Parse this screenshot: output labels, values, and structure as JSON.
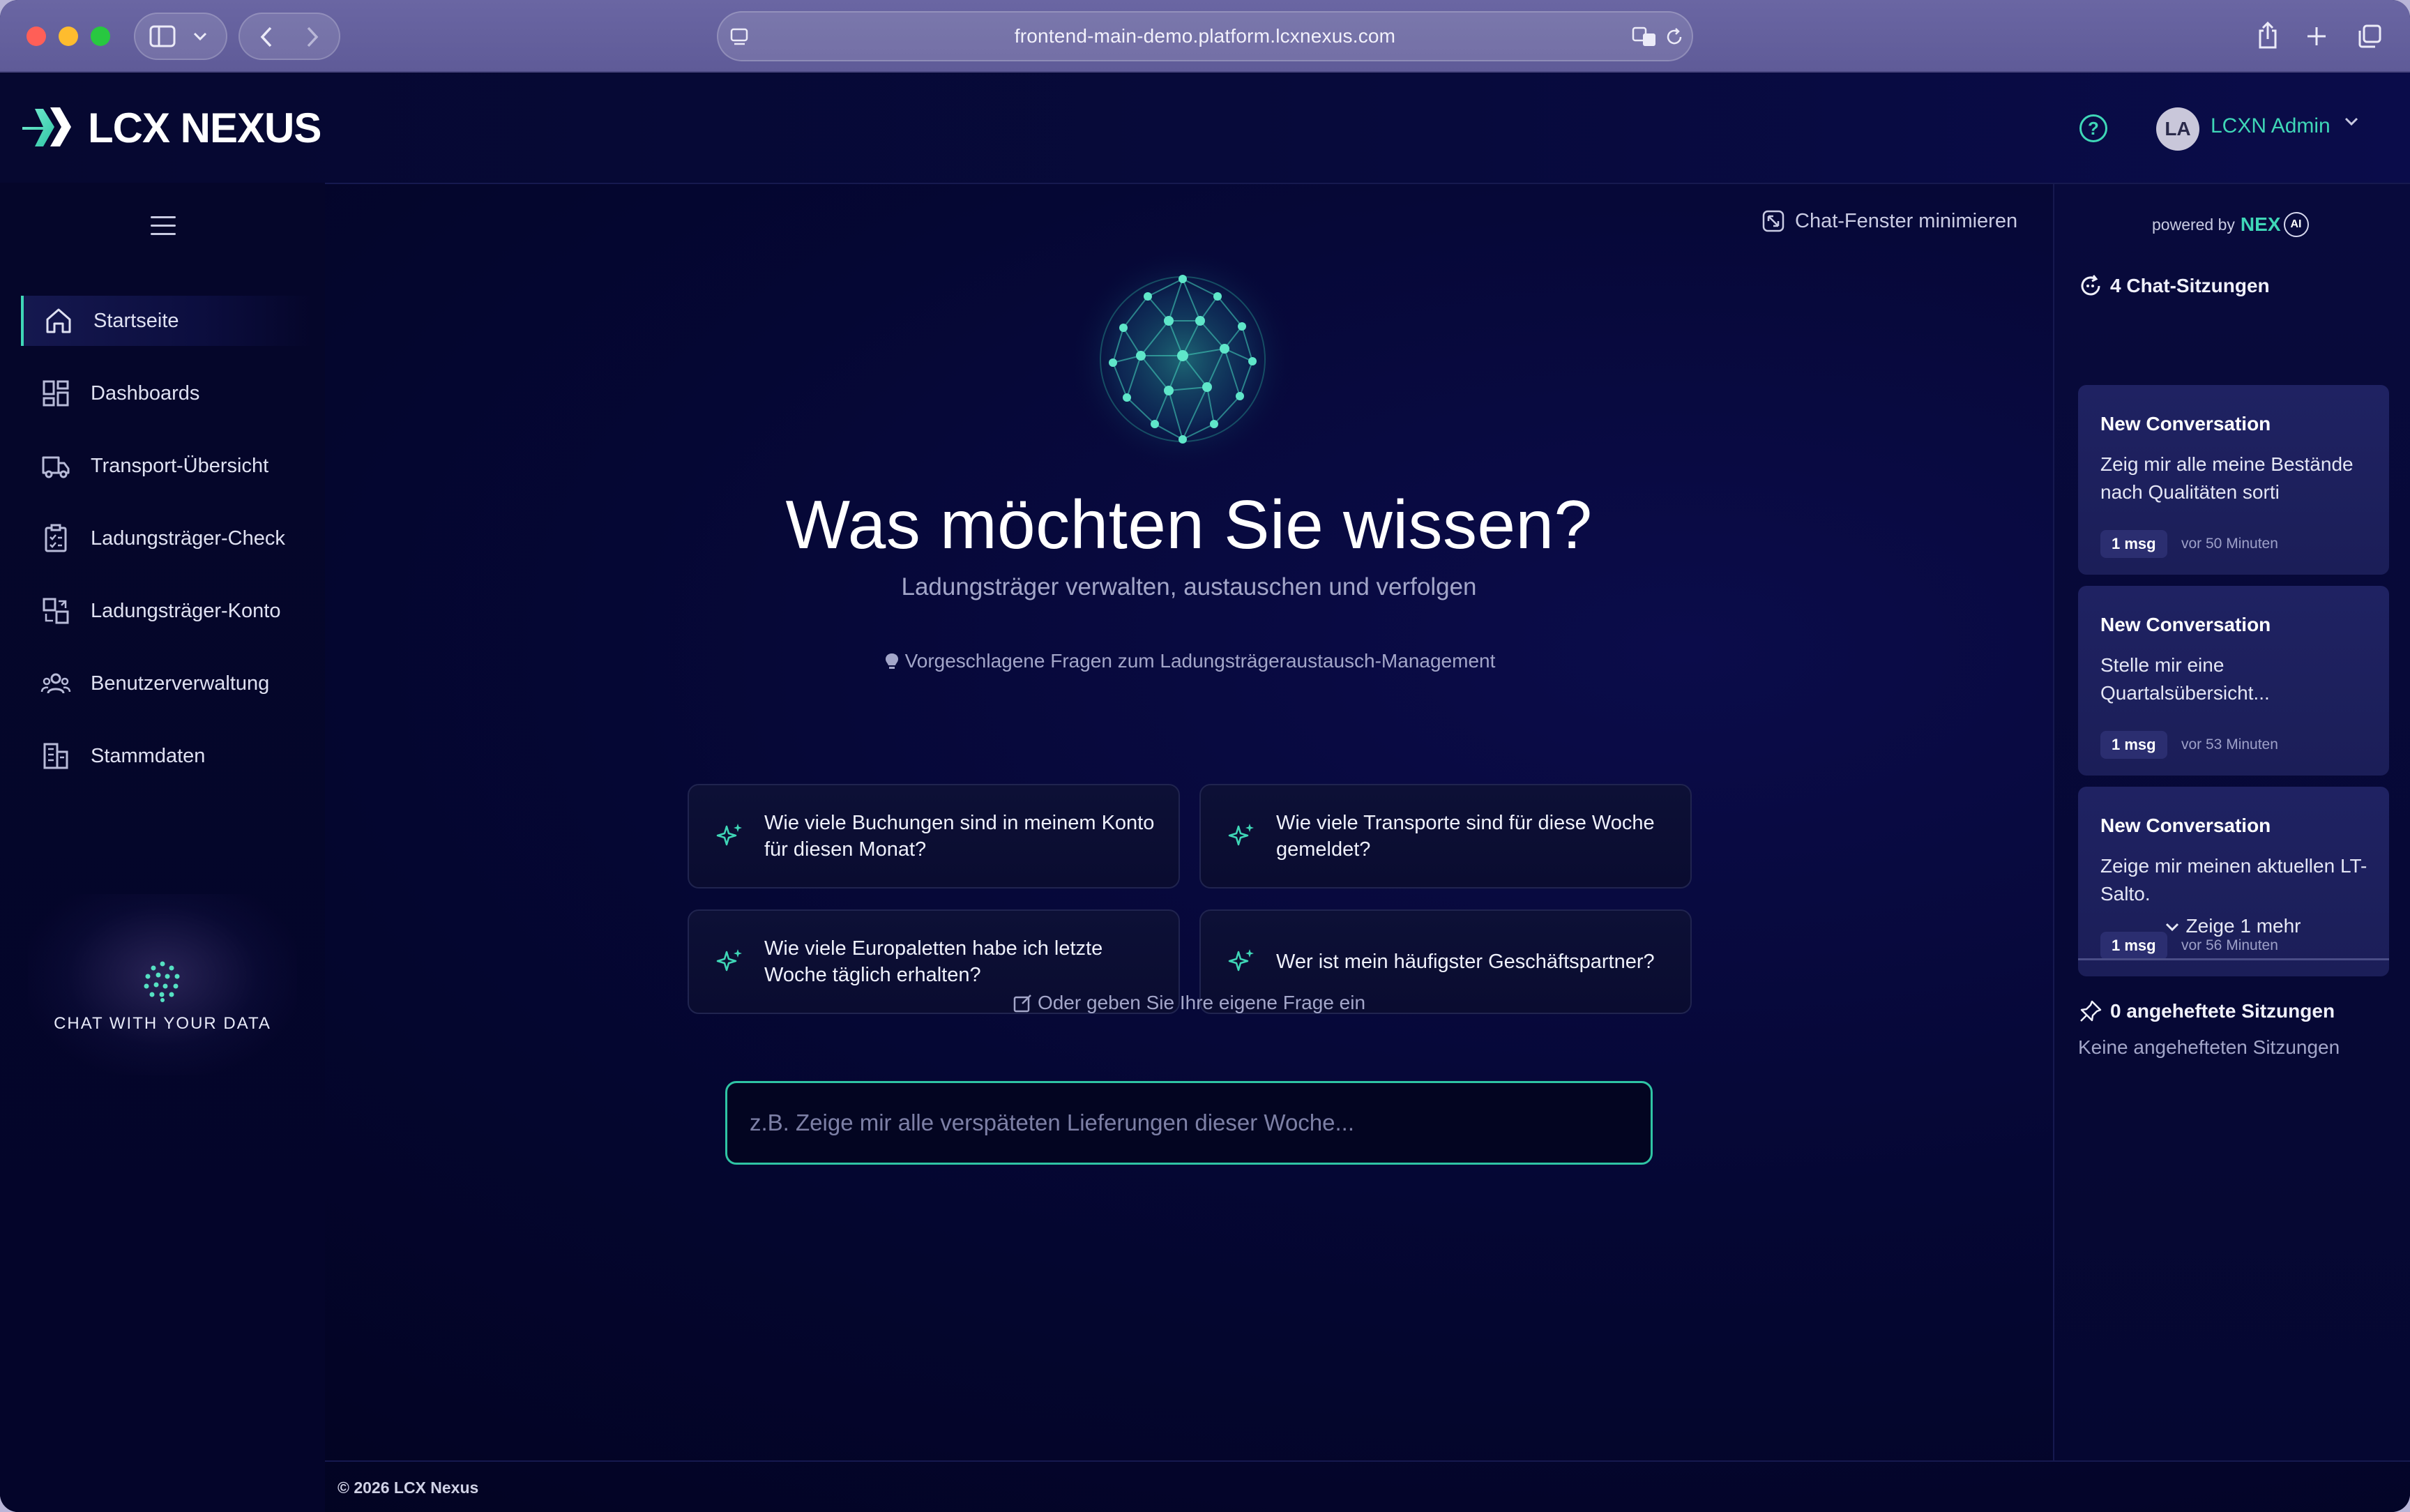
{
  "browser": {
    "url": "frontend-main-demo.platform.lcxnexus.com"
  },
  "header": {
    "logo_text": "LCX NEXUS",
    "user_initials": "LA",
    "user_name": "LCXN Admin"
  },
  "sidebar": {
    "items": [
      {
        "label": "Startseite",
        "icon": "home-icon",
        "active": true
      },
      {
        "label": "Dashboards",
        "icon": "dashboard-icon",
        "active": false
      },
      {
        "label": "Transport-Übersicht",
        "icon": "truck-icon",
        "active": false
      },
      {
        "label": "Ladungsträger-Check",
        "icon": "clipboard-check-icon",
        "active": false
      },
      {
        "label": "Ladungsträger-Konto",
        "icon": "exchange-icon",
        "active": false
      },
      {
        "label": "Benutzerverwaltung",
        "icon": "users-icon",
        "active": false
      },
      {
        "label": "Stammdaten",
        "icon": "building-icon",
        "active": false
      }
    ],
    "chat_with_data_label": "CHAT WITH YOUR DATA"
  },
  "main": {
    "minimize_label": "Chat-Fenster minimieren",
    "headline": "Was möchten Sie wissen?",
    "subheadline": "Ladungsträger verwalten, austauschen und verfolgen",
    "suggestions_title": "Vorgeschlagene Fragen zum Ladungsträgeraustausch-Management",
    "suggestions": [
      "Wie viele Buchungen sind in meinem Konto für diesen Monat?",
      "Wie viele Transporte sind für diese Woche gemeldet?",
      "Wie viele Europaletten habe ich letzte Woche täglich erhalten?",
      "Wer ist mein häufigster Geschäftspartner?"
    ],
    "own_question_label": "Oder geben Sie Ihre eigene Frage ein",
    "input_placeholder": "z.B. Zeige mir alle verspäteten Lieferungen dieser Woche..."
  },
  "right_panel": {
    "powered_by": "powered by",
    "brand": "NEX",
    "brand_badge": "AI",
    "sessions_title": "4 Chat-Sitzungen",
    "sessions": [
      {
        "title": "New Conversation",
        "preview": "Zeig mir alle meine Bestände nach Qualitäten sorti",
        "msgs": "1 msg",
        "time": "vor 50 Minuten"
      },
      {
        "title": "New Conversation",
        "preview": "Stelle mir eine Quartalsübersicht...",
        "msgs": "1 msg",
        "time": "vor 53 Minuten"
      },
      {
        "title": "New Conversation",
        "preview": "Zeige mir meinen aktuellen LT-Salto.",
        "msgs": "1 msg",
        "time": "vor 56 Minuten"
      }
    ],
    "show_more": "Zeige 1 mehr",
    "pinned_title": "0 angeheftete Sitzungen",
    "pinned_empty": "Keine angehefteten Sitzungen"
  },
  "footer": {
    "copyright": "© 2026 LCX Nexus"
  },
  "colors": {
    "accent": "#3fd7b7",
    "background": "#03052a",
    "card": "#1f2262"
  }
}
